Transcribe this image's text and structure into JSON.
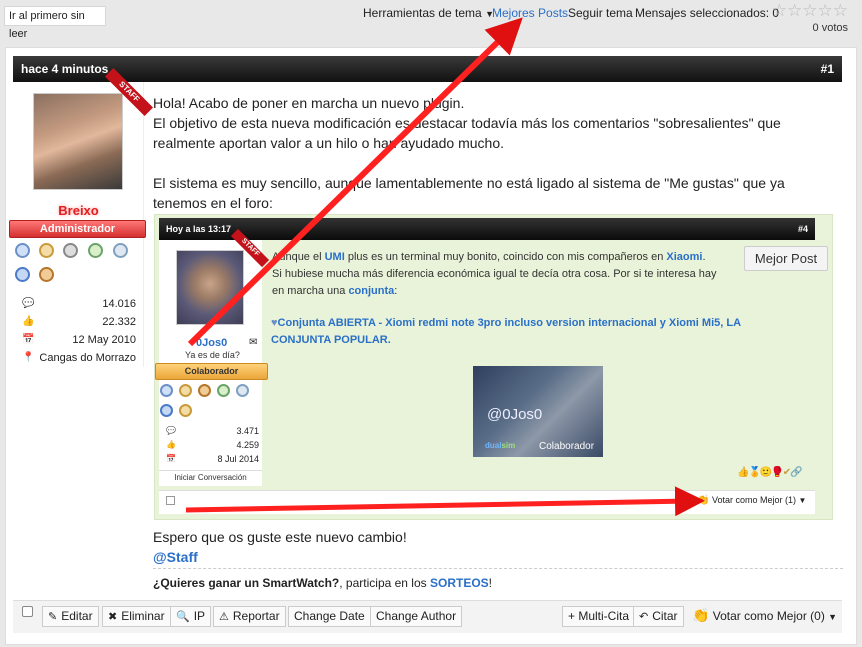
{
  "top": {
    "first_unread": "Ir al primero sin leer",
    "thread_tools": "Herramientas de tema",
    "best_posts": "Mejores Posts",
    "follow": "Seguir tema",
    "selected": "Mensajes seleccionados: 0",
    "votes": "0 votos",
    "rating_stars": 0
  },
  "post": {
    "time": "hace 4 minutos",
    "number": "#1",
    "staff_ribbon": "STAFF",
    "username": "Breixo",
    "role": "Administrador",
    "stats": [
      {
        "icon": "comments-icon",
        "glyph": "💬",
        "value": "14.016"
      },
      {
        "icon": "thumbs-up-icon",
        "glyph": "👍",
        "value": "22.332"
      },
      {
        "icon": "calendar-icon",
        "glyph": "📅",
        "value": "12 May 2010"
      },
      {
        "icon": "location-icon",
        "glyph": "📍",
        "value": "Cangas do Morrazo"
      }
    ],
    "body_lines": [
      "Hola! Acabo de poner en marcha un nuevo plugin.",
      "El objetivo de esta nueva modificación es destacar todavía más los comentarios \"sobresalientes\" que",
      "realmente aportan valor a un hilo o han ayudado mucho.",
      "",
      "El sistema es muy sencillo, aunque lamentablemente no está ligado al sistema de \"Me gustas\" que ya",
      "tenemos en el foro:"
    ],
    "footer_lines": [
      "Espero que os guste este nuevo cambio!",
      "@Staff"
    ],
    "signature": {
      "bold": "¿Quieres ganar un SmartWatch?",
      "mid": ", participa en los ",
      "link": "SORTEOS",
      "end": "!"
    }
  },
  "quoted": {
    "time": "Hoy a las 13:17",
    "number": "#4",
    "staff_ribbon": "STAFF",
    "username": "0Jos0",
    "status": "Ya es de día?",
    "role": "Colaborador",
    "stats": [
      {
        "icon": "comments-icon",
        "glyph": "💬",
        "value": "3.471"
      },
      {
        "icon": "thumbs-up-icon",
        "glyph": "👍",
        "value": "4.259"
      },
      {
        "icon": "calendar-icon",
        "glyph": "📅",
        "value": "8 Jul 2014"
      }
    ],
    "start_conversation": "Iniciar Conversación",
    "best_post_button": "Mejor Post",
    "text1a": "Aunque el ",
    "text1b": "UMI",
    "text1c": " plus es un terminal muy bonito, coincido con mis compañeros en ",
    "text1d": "Xiaomi",
    "text1e": ".",
    "text2": "Si hubiese mucha más diferencia económica igual te decía otra cosa. Por si te interesa hay",
    "text3a": "en marcha una ",
    "text3b": "conjunta",
    "text3c": ":",
    "link_line1": "Conjunta ABIERTA - Xiomi redmi note 3pro incluso version internacional y Xiomi Mi5, LA",
    "link_line2": "CONJUNTA POPULAR.",
    "banner_name": "@0Jos0",
    "banner_brand_a": "dual",
    "banner_brand_b": "sim",
    "banner_role": "Colaborador",
    "vote_label": "Votar como Mejor (1)"
  },
  "actions": {
    "edit": "Editar",
    "delete": "Eliminar",
    "ip": "IP",
    "report": "Reportar",
    "change_date": "Change Date",
    "change_author": "Change Author",
    "multi_quote": "+ Multi-Cita",
    "quote": "Citar",
    "vote": "Votar como Mejor (0)"
  },
  "colors": {
    "accent": "#2a6fc8",
    "staff": "#c4121a",
    "admin_bar": "#e04040",
    "collab_bar": "#f5b042",
    "arrow": "#e01010"
  }
}
